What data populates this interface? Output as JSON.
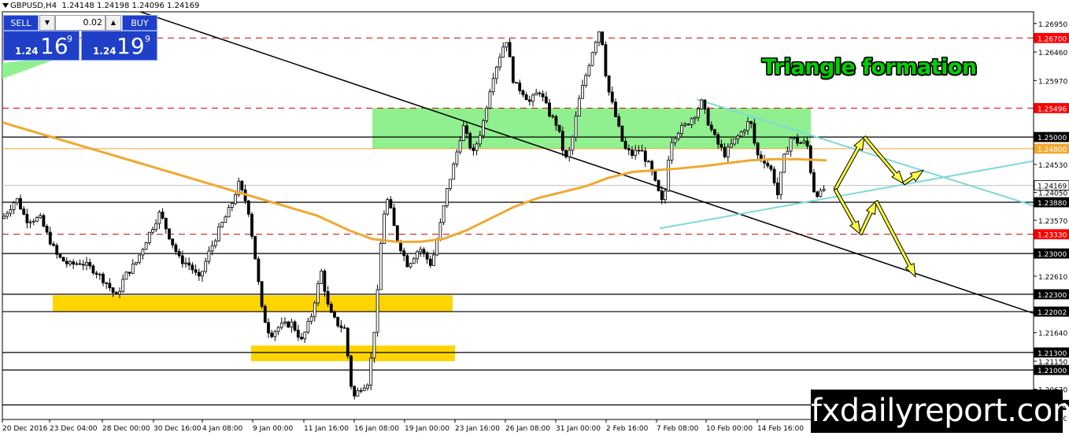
{
  "header": {
    "symbol": "GBPUSD,H4",
    "ohlc": "1.24148 1.24198 1.24096 1.24169"
  },
  "trade_panel": {
    "sell_label": "SELL",
    "buy_label": "BUY",
    "lot": "0.02",
    "bid_prefix": "1.24",
    "bid_big": "16",
    "bid_sup": "9",
    "ask_prefix": "1.24",
    "ask_big": "19",
    "ask_sup": "9"
  },
  "caption": "Triangle formation",
  "watermark": "fxdailyreport.com",
  "colors": {
    "bull": "#ffffff",
    "bear": "#000000",
    "ma": "#f0a830",
    "triangle": "#7fd8d8",
    "zone_green": "#90f090",
    "zone_yellow": "#ffd400",
    "marker_red": "#ff0000",
    "arrow_fill": "#ffff40"
  },
  "chart_data": {
    "type": "candlestick",
    "title": "GBPUSD,H4",
    "ylim": [
      1.2015,
      1.2715
    ],
    "price_scale_ticks": [
      "1.26950",
      "1.26460",
      "1.25970",
      "1.25040",
      "1.24530",
      "1.24050",
      "1.23570",
      "1.22610",
      "1.21640",
      "1.21150",
      "1.20670",
      "1.20180"
    ],
    "price_markers": [
      {
        "price": 1.267,
        "label": "1.26700",
        "style": "red-dashed"
      },
      {
        "price": 1.25496,
        "label": "1.25496",
        "style": "red-dashed"
      },
      {
        "price": 1.25,
        "label": "1.25000",
        "style": "black"
      },
      {
        "price": 1.248,
        "label": "1.24800",
        "style": "orange"
      },
      {
        "price": 1.24169,
        "label": "1.24169",
        "style": "gray"
      },
      {
        "price": 1.2388,
        "label": "1.23880",
        "style": "black"
      },
      {
        "price": 1.2333,
        "label": "1.23330",
        "style": "red-dashed"
      },
      {
        "price": 1.23,
        "label": "1.23000",
        "style": "black"
      },
      {
        "price": 1.223,
        "label": "1.22300",
        "style": "black"
      },
      {
        "price": 1.22002,
        "label": "1.22002",
        "style": "black"
      },
      {
        "price": 1.213,
        "label": "1.21300",
        "style": "black"
      },
      {
        "price": 1.21,
        "label": "1.21000",
        "style": "black"
      },
      {
        "price": 1.204,
        "label": "1.20400",
        "style": "black"
      }
    ],
    "x_labels": [
      "20 Dec 2016",
      "23 Dec 04:00",
      "28 Dec 00:00",
      "30 Dec 16:00",
      "4 Jan 08:00",
      "9 Jan 00:00",
      "11 Jan 16:00",
      "16 Jan 08:00",
      "19 Jan 00:00",
      "23 Jan 16:00",
      "26 Jan 08:00",
      "31 Jan 00:00",
      "2 Feb 16:00",
      "7 Feb 08:00",
      "10 Feb 00:00",
      "14 Feb 16:00"
    ],
    "zones": [
      {
        "color": "green",
        "from": 1.248,
        "to": 1.255
      },
      {
        "color": "yellow",
        "from": 1.22,
        "to": 1.2228
      },
      {
        "color": "yellow",
        "from": 1.2115,
        "to": 1.2142
      }
    ],
    "path_points": [
      [
        0,
        1.236
      ],
      [
        18,
        1.2395
      ],
      [
        30,
        1.2358
      ],
      [
        48,
        1.236
      ],
      [
        56,
        1.2335
      ],
      [
        70,
        1.2295
      ],
      [
        85,
        1.228
      ],
      [
        100,
        1.2285
      ],
      [
        118,
        1.227
      ],
      [
        132,
        1.225
      ],
      [
        145,
        1.2225
      ],
      [
        155,
        1.226
      ],
      [
        170,
        1.2285
      ],
      [
        185,
        1.233
      ],
      [
        200,
        1.237
      ],
      [
        212,
        1.233
      ],
      [
        225,
        1.229
      ],
      [
        238,
        1.228
      ],
      [
        250,
        1.2255
      ],
      [
        262,
        1.23
      ],
      [
        275,
        1.234
      ],
      [
        290,
        1.238
      ],
      [
        300,
        1.242
      ],
      [
        312,
        1.238
      ],
      [
        322,
        1.2285
      ],
      [
        330,
        1.22
      ],
      [
        340,
        1.216
      ],
      [
        352,
        1.2175
      ],
      [
        368,
        1.218
      ],
      [
        380,
        1.215
      ],
      [
        392,
        1.219
      ],
      [
        405,
        1.227
      ],
      [
        415,
        1.22
      ],
      [
        425,
        1.218
      ],
      [
        435,
        1.217
      ],
      [
        445,
        1.205
      ],
      [
        455,
        1.207
      ],
      [
        465,
        1.208
      ],
      [
        475,
        1.22
      ],
      [
        483,
        1.236
      ],
      [
        490,
        1.2395
      ],
      [
        500,
        1.233
      ],
      [
        515,
        1.228
      ],
      [
        530,
        1.231
      ],
      [
        545,
        1.228
      ],
      [
        555,
        1.234
      ],
      [
        565,
        1.241
      ],
      [
        575,
        1.246
      ],
      [
        585,
        1.252
      ],
      [
        598,
        1.247
      ],
      [
        610,
        1.252
      ],
      [
        622,
        1.26
      ],
      [
        632,
        1.264
      ],
      [
        640,
        1.267
      ],
      [
        650,
        1.259
      ],
      [
        660,
        1.258
      ],
      [
        670,
        1.256
      ],
      [
        682,
        1.258
      ],
      [
        695,
        1.254
      ],
      [
        705,
        1.252
      ],
      [
        715,
        1.246
      ],
      [
        722,
        1.248
      ],
      [
        732,
        1.256
      ],
      [
        742,
        1.261
      ],
      [
        752,
        1.266
      ],
      [
        760,
        1.269
      ],
      [
        768,
        1.259
      ],
      [
        778,
        1.254
      ],
      [
        790,
        1.248
      ],
      [
        800,
        1.247
      ],
      [
        810,
        1.248
      ],
      [
        822,
        1.245
      ],
      [
        832,
        1.241
      ],
      [
        840,
        1.238
      ],
      [
        848,
        1.249
      ],
      [
        858,
        1.251
      ],
      [
        868,
        1.252
      ],
      [
        880,
        1.254
      ],
      [
        888,
        1.256
      ],
      [
        898,
        1.252
      ],
      [
        908,
        1.249
      ],
      [
        918,
        1.247
      ],
      [
        928,
        1.249
      ],
      [
        940,
        1.251
      ],
      [
        950,
        1.253
      ],
      [
        958,
        1.247
      ],
      [
        968,
        1.246
      ],
      [
        978,
        1.244
      ],
      [
        985,
        1.24
      ],
      [
        992,
        1.246
      ],
      [
        1002,
        1.25
      ],
      [
        1012,
        1.249
      ],
      [
        1022,
        1.249
      ],
      [
        1030,
        1.241
      ],
      [
        1038,
        1.24
      ],
      [
        1046,
        1.2415
      ]
    ],
    "ma_points": [
      [
        0,
        1.2525
      ],
      [
        50,
        1.2505
      ],
      [
        100,
        1.2485
      ],
      [
        150,
        1.2465
      ],
      [
        200,
        1.2445
      ],
      [
        250,
        1.2425
      ],
      [
        300,
        1.2405
      ],
      [
        350,
        1.2385
      ],
      [
        400,
        1.2365
      ],
      [
        440,
        1.234
      ],
      [
        470,
        1.2325
      ],
      [
        500,
        1.232
      ],
      [
        530,
        1.232
      ],
      [
        560,
        1.2325
      ],
      [
        590,
        1.234
      ],
      [
        620,
        1.236
      ],
      [
        650,
        1.238
      ],
      [
        680,
        1.2395
      ],
      [
        710,
        1.2405
      ],
      [
        740,
        1.2415
      ],
      [
        770,
        1.243
      ],
      [
        800,
        1.244
      ],
      [
        830,
        1.2443
      ],
      [
        860,
        1.2446
      ],
      [
        890,
        1.245
      ],
      [
        920,
        1.2455
      ],
      [
        950,
        1.246
      ],
      [
        980,
        1.2462
      ],
      [
        1010,
        1.2462
      ],
      [
        1047,
        1.246
      ]
    ],
    "trend_lines": [
      {
        "color": "black",
        "from": [
          0,
          1.2795
        ],
        "to": [
          1315,
          1.2195
        ]
      },
      {
        "color": "black",
        "from": [
          200,
          1.2795
        ],
        "to": [
          275,
          1.2825
        ]
      },
      {
        "color": "cyan",
        "from": [
          882,
          1.2565
        ],
        "to": [
          1315,
          1.238
        ]
      },
      {
        "color": "cyan",
        "from": [
          835,
          1.2343
        ],
        "to": [
          1315,
          1.246
        ]
      }
    ],
    "scenario_arrows": [
      {
        "from": [
          1058,
          1.241
        ],
        "to": [
          1095,
          1.25
        ]
      },
      {
        "from": [
          1095,
          1.25
        ],
        "to": [
          1145,
          1.242
        ]
      },
      {
        "from": [
          1145,
          1.242
        ],
        "to": [
          1170,
          1.2443
        ]
      },
      {
        "from": [
          1058,
          1.241
        ],
        "to": [
          1090,
          1.2333
        ]
      },
      {
        "from": [
          1090,
          1.2333
        ],
        "to": [
          1110,
          1.239
        ]
      },
      {
        "from": [
          1110,
          1.239
        ],
        "to": [
          1160,
          1.226
        ]
      }
    ]
  }
}
